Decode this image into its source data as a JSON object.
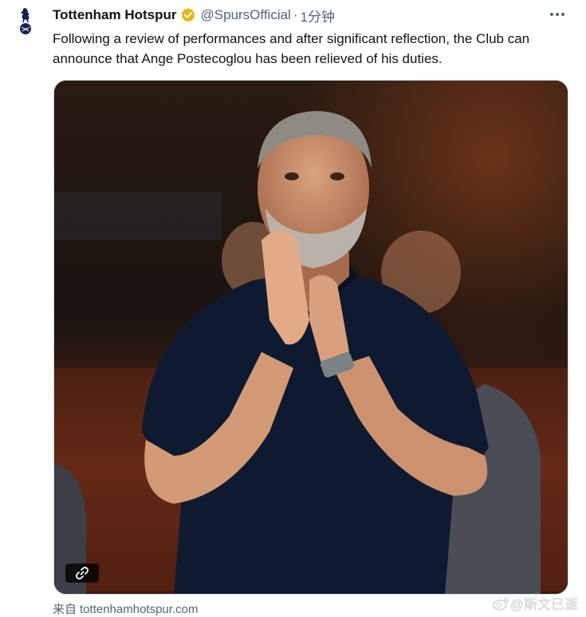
{
  "tweet": {
    "author_name": "Tottenham Hotspur",
    "handle": "@SpursOfficial",
    "separator": "·",
    "time": "1分钟",
    "text": "Following a review of performances and after significant reflection, the Club can announce that Ange Postecoglou has been relieved of his duties.",
    "source_label": "来自",
    "source_domain": "tottenhamhotspur.com"
  },
  "watermark": {
    "text": "@斯文已逝",
    "icon": "weibo-icon"
  },
  "icons": {
    "avatar": "spurs-cockerel-logo",
    "verified": "verified-badge-icon",
    "more": "more-options-icon",
    "link": "link-icon"
  },
  "colors": {
    "verified_gold": "#E2B719",
    "spurs_navy": "#132257",
    "muted_text": "#536471"
  }
}
